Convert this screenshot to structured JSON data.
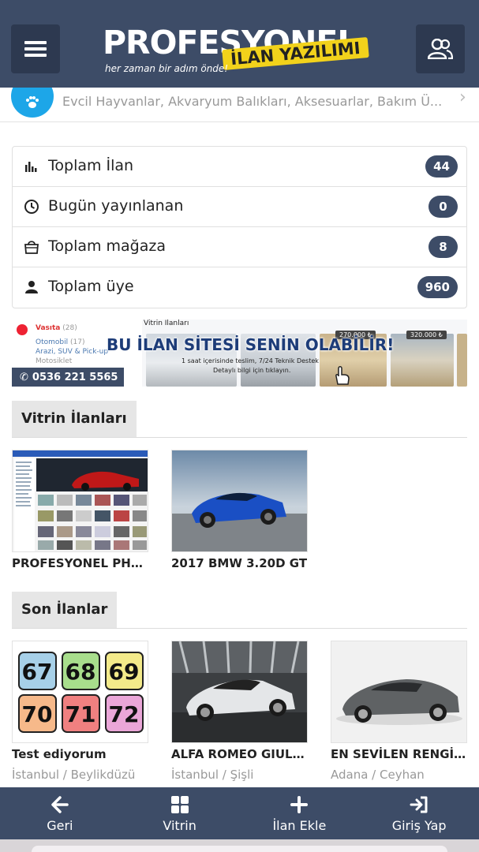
{
  "header": {
    "logo_main": "PROFESYONEL",
    "logo_badge": "İLAN YAZILIMI",
    "logo_slogan": "her zaman bir adım önde!"
  },
  "category_row": {
    "subtitle": "Evcil Hayvanlar, Akvaryum Balıkları, Aksesuarlar, Bakım Ü..."
  },
  "stats": [
    {
      "label": "Toplam İlan",
      "value": "44",
      "icon": "bar-chart-icon"
    },
    {
      "label": "Bugün yayınlanan",
      "value": "0",
      "icon": "clock-icon"
    },
    {
      "label": "Toplam mağaza",
      "value": "8",
      "icon": "shopping-bag-icon"
    },
    {
      "label": "Toplam üye",
      "value": "960",
      "icon": "user-icon"
    }
  ],
  "banner": {
    "category": "Vasıta",
    "category_count": "(28)",
    "sub1": "Otomobil",
    "sub1_count": "(17)",
    "sub2": "Arazi, SUV & Pick-up",
    "sub3": "Motosiklet",
    "vitrin_title": "Vitrin İlanları",
    "headline": "BU İLAN SİTESİ SENİN OLABİLİR!",
    "note1": "1 saat içerisinde teslim, 7/24 Teknik Destek",
    "note2": "Detaylı bilgi için tıklayın.",
    "phone": "0536 221 5565",
    "price1": "270.000 ₺",
    "price2": "320.000 ₺"
  },
  "vitrin": {
    "title": "Vitrin İlanları",
    "items": [
      {
        "title": "PROFESYONEL PHP İ..."
      },
      {
        "title": "2017 BMW 3.20D GT"
      }
    ]
  },
  "son": {
    "title": "Son İlanlar",
    "items": [
      {
        "title": "Test ediyorum",
        "location": "İstanbul / Beylikdüzü"
      },
      {
        "title": "ALFA ROMEO GIULIA...",
        "location": "İstanbul / Şişli"
      },
      {
        "title": "EN SEVİLEN RENGİ İL...",
        "location": "Adana / Ceyhan"
      }
    ]
  },
  "test_numbers": [
    "67",
    "68",
    "69",
    "70",
    "71",
    "72"
  ],
  "bottom_nav": [
    {
      "label": "Geri",
      "icon": "arrow-left-icon"
    },
    {
      "label": "Vitrin",
      "icon": "grid-icon"
    },
    {
      "label": "İlan Ekle",
      "icon": "plus-icon"
    },
    {
      "label": "Giriş Yap",
      "icon": "login-icon"
    }
  ],
  "colors": {
    "header_bg": "#3d4c67",
    "badge_bg": "#3d4c67",
    "category_circle": "#1da6e8",
    "logo_badge": "#f2d21b"
  }
}
